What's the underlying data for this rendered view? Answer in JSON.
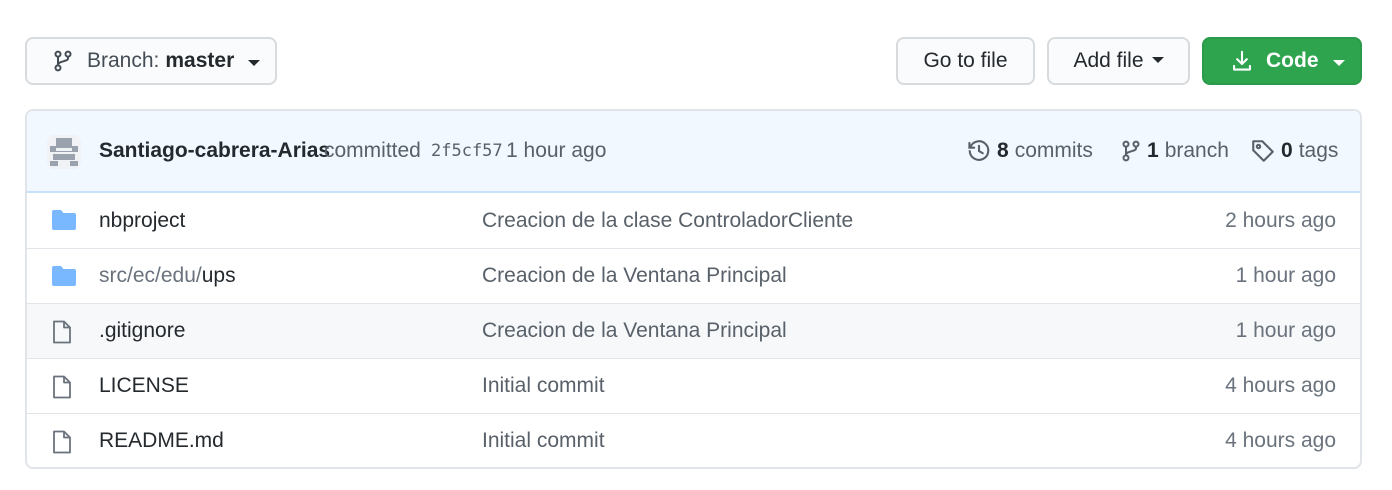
{
  "toolbar": {
    "branch_prefix": "Branch:",
    "branch_name": "master",
    "go_to_file": "Go to file",
    "add_file": "Add file",
    "code": "Code"
  },
  "latest_commit": {
    "author": "Santiago-cabrera-Arias",
    "action": "committed",
    "sha": "2f5cf57",
    "time": "1 hour ago"
  },
  "stats": {
    "commits_count": "8",
    "commits_label": "commits",
    "branches_count": "1",
    "branches_label": "branch",
    "tags_count": "0",
    "tags_label": "tags"
  },
  "files": [
    {
      "icon": "folder-icon",
      "name_prefix": "",
      "name": "nbproject",
      "message": "Creacion de la clase ControladorCliente",
      "age": "2 hours ago"
    },
    {
      "icon": "folder-icon",
      "name_prefix": "src/ec/edu/",
      "name": "ups",
      "message": "Creacion de la Ventana Principal",
      "age": "1 hour ago"
    },
    {
      "icon": "file-icon",
      "name_prefix": "",
      "name": ".gitignore",
      "message": "Creacion de la Ventana Principal",
      "age": "1 hour ago"
    },
    {
      "icon": "file-icon",
      "name_prefix": "",
      "name": "LICENSE",
      "message": "Initial commit",
      "age": "4 hours ago"
    },
    {
      "icon": "file-icon",
      "name_prefix": "",
      "name": "README.md",
      "message": "Initial commit",
      "age": "4 hours ago"
    }
  ],
  "colors": {
    "code_button": "#2ea44f",
    "commit_bar_bg": "#f1f8ff",
    "folder": "#79b8ff"
  }
}
